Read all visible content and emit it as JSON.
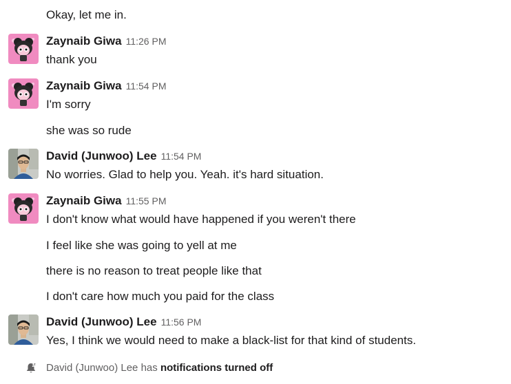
{
  "messages": [
    {
      "continuation": "Okay, let me in."
    },
    {
      "sender": "Zaynaib Giwa",
      "time": "11:26 PM",
      "lines": [
        "thank you"
      ]
    },
    {
      "sender": "Zaynaib Giwa",
      "time": "11:54 PM",
      "lines": [
        "I'm sorry",
        "she was so rude"
      ]
    },
    {
      "sender": "David (Junwoo) Lee",
      "time": "11:54 PM",
      "lines": [
        "No worries. Glad to help you.  Yeah. it's hard situation."
      ]
    },
    {
      "sender": "Zaynaib Giwa",
      "time": "11:55 PM",
      "lines": [
        "I don't know what would have happened if you weren't there",
        "I feel like she was going to yell at me",
        "there is no reason to treat people like that",
        "I don't care how much you paid for the class"
      ]
    },
    {
      "sender": "David (Junwoo) Lee",
      "time": "11:56 PM",
      "lines": [
        "Yes, I think we would need to make a black-list for that kind of students."
      ]
    }
  ],
  "footer": {
    "icon": "bell-off-icon",
    "prefix": "David (Junwoo) Lee has ",
    "emphasis": "notifications turned off"
  },
  "colors": {
    "text": "#1d1c1d",
    "muted": "#616061",
    "zaynaib_avatar_bg": "#f08bc0"
  }
}
